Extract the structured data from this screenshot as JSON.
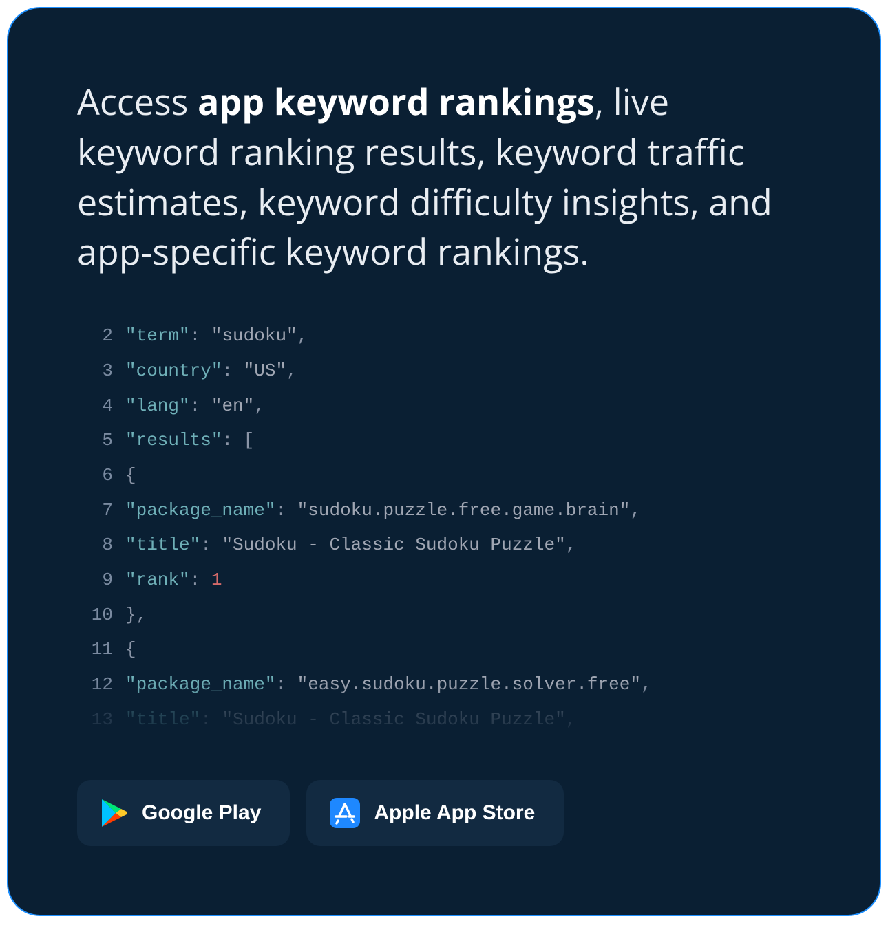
{
  "headline": {
    "pre": "Access ",
    "strong": "app keyword rankings",
    "post": ", live keyword ranking results, keyword traffic estimates, keyword difficulty insights, and app-specific keyword rankings."
  },
  "code": {
    "lines": [
      {
        "n": 2,
        "tokens": [
          [
            "key",
            "\"term\""
          ],
          [
            "punc",
            ": "
          ],
          [
            "str",
            "\"sudoku\""
          ],
          [
            "punc",
            ","
          ]
        ]
      },
      {
        "n": 3,
        "tokens": [
          [
            "key",
            "\"country\""
          ],
          [
            "punc",
            ": "
          ],
          [
            "str",
            "\"US\""
          ],
          [
            "punc",
            ","
          ]
        ]
      },
      {
        "n": 4,
        "tokens": [
          [
            "key",
            "\"lang\""
          ],
          [
            "punc",
            ": "
          ],
          [
            "str",
            "\"en\""
          ],
          [
            "punc",
            ","
          ]
        ]
      },
      {
        "n": 5,
        "tokens": [
          [
            "key",
            "\"results\""
          ],
          [
            "punc",
            ": ["
          ]
        ]
      },
      {
        "n": 6,
        "tokens": [
          [
            "punc",
            "{"
          ]
        ]
      },
      {
        "n": 7,
        "tokens": [
          [
            "key",
            "\"package_name\""
          ],
          [
            "punc",
            ": "
          ],
          [
            "str",
            "\"sudoku.puzzle.free.game.brain\""
          ],
          [
            "punc",
            ","
          ]
        ]
      },
      {
        "n": 8,
        "tokens": [
          [
            "key",
            "\"title\""
          ],
          [
            "punc",
            ": "
          ],
          [
            "str",
            "\"Sudoku - Classic Sudoku Puzzle\""
          ],
          [
            "punc",
            ","
          ]
        ]
      },
      {
        "n": 9,
        "tokens": [
          [
            "key",
            "\"rank\""
          ],
          [
            "punc",
            ": "
          ],
          [
            "num",
            "1"
          ]
        ]
      },
      {
        "n": 10,
        "tokens": [
          [
            "punc",
            "},"
          ]
        ]
      },
      {
        "n": 11,
        "tokens": [
          [
            "punc",
            "{"
          ]
        ]
      },
      {
        "n": 12,
        "tokens": [
          [
            "key",
            "\"package_name\""
          ],
          [
            "punc",
            ": "
          ],
          [
            "str",
            "\"easy.sudoku.puzzle.solver.free\""
          ],
          [
            "punc",
            ","
          ]
        ]
      },
      {
        "n": 13,
        "tokens": [
          [
            "key",
            "\"title\""
          ],
          [
            "punc",
            ": "
          ],
          [
            "str",
            "\"Sudoku - Classic Sudoku Puzzle\""
          ],
          [
            "punc",
            ","
          ]
        ],
        "fade": true
      }
    ]
  },
  "stores": {
    "google_play": "Google Play",
    "apple_app_store": "Apple App Store"
  }
}
